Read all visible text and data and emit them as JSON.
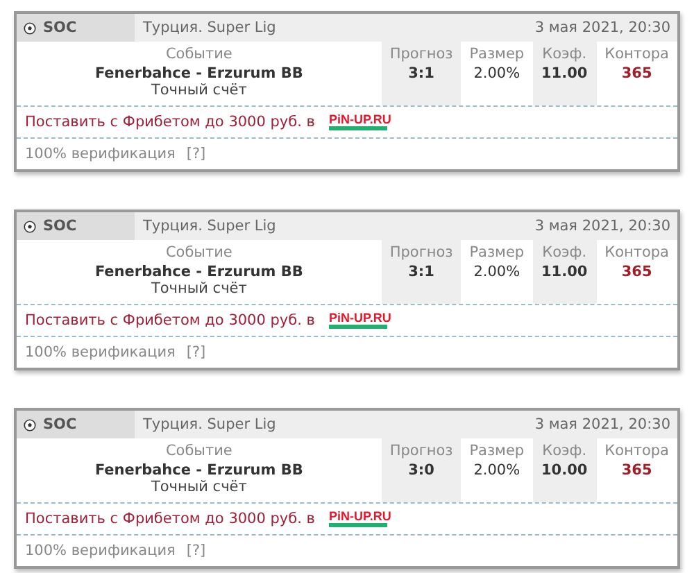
{
  "cards": [
    {
      "sport": "SOC",
      "league": "Турция. Super Lig",
      "date": "3 мая 2021, 20:30",
      "event_label": "Событие",
      "event": "Fenerbahce - Erzurum BB",
      "market": "Точный счёт",
      "columns": [
        {
          "label": "Прогноз",
          "value": "3:1",
          "kind": "bold"
        },
        {
          "label": "Размер",
          "value": "2.00%",
          "kind": "plain"
        },
        {
          "label": "Коэф.",
          "value": "11.00",
          "kind": "bold"
        },
        {
          "label": "Контора",
          "value": "365",
          "kind": "accent"
        }
      ],
      "promo": "Поставить с Фрибетом до 3000 руб. в",
      "promo_logo": "PiN-UP.RU",
      "verification": "100% верификация",
      "help": "[?]"
    },
    {
      "sport": "SOC",
      "league": "Турция. Super Lig",
      "date": "3 мая 2021, 20:30",
      "event_label": "Событие",
      "event": "Fenerbahce - Erzurum BB",
      "market": "Точный счёт",
      "columns": [
        {
          "label": "Прогноз",
          "value": "3:1",
          "kind": "bold"
        },
        {
          "label": "Размер",
          "value": "2.00%",
          "kind": "plain"
        },
        {
          "label": "Коэф.",
          "value": "11.00",
          "kind": "bold"
        },
        {
          "label": "Контора",
          "value": "365",
          "kind": "accent"
        }
      ],
      "promo": "Поставить с Фрибетом до 3000 руб. в",
      "promo_logo": "PiN-UP.RU",
      "verification": "100% верификация",
      "help": "[?]"
    },
    {
      "sport": "SOC",
      "league": "Турция. Super Lig",
      "date": "3 мая 2021, 20:30",
      "event_label": "Событие",
      "event": "Fenerbahce - Erzurum BB",
      "market": "Точный счёт",
      "columns": [
        {
          "label": "Прогноз",
          "value": "3:0",
          "kind": "bold"
        },
        {
          "label": "Размер",
          "value": "2.00%",
          "kind": "plain"
        },
        {
          "label": "Коэф.",
          "value": "10.00",
          "kind": "bold"
        },
        {
          "label": "Контора",
          "value": "365",
          "kind": "accent"
        }
      ],
      "promo": "Поставить с Фрибетом до 3000 руб. в",
      "promo_logo": "PiN-UP.RU",
      "verification": "100% верификация",
      "help": "[?]"
    }
  ]
}
